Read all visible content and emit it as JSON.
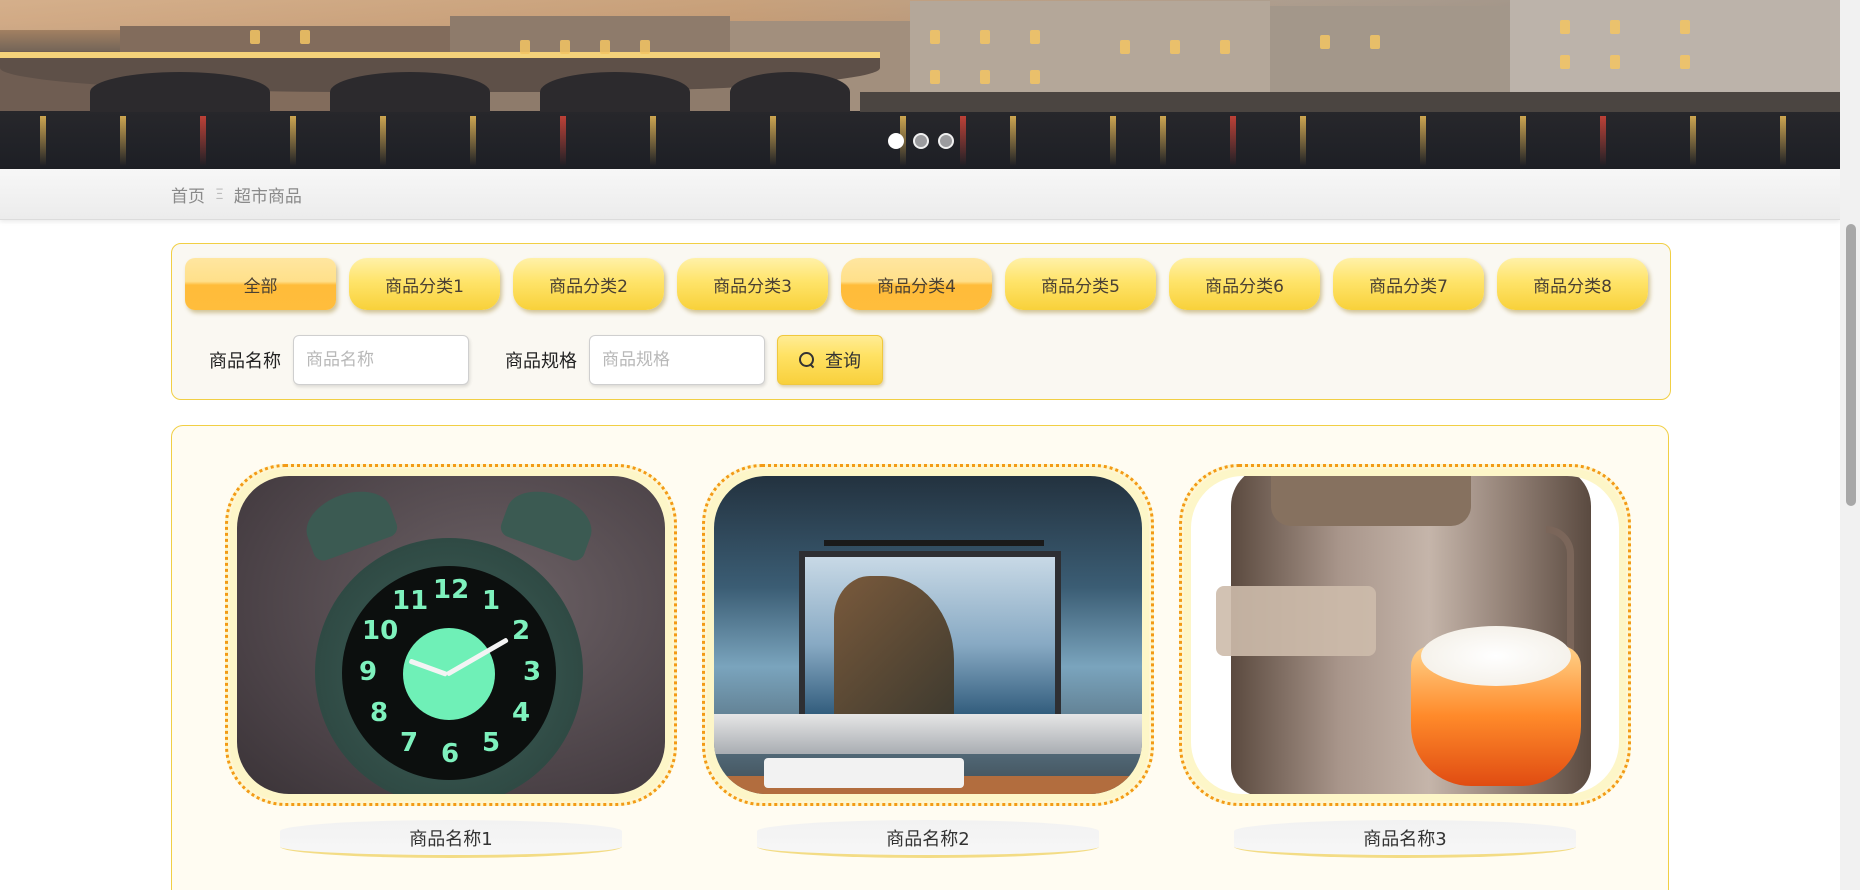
{
  "carousel": {
    "slide_count": 3,
    "active_index": 0
  },
  "breadcrumb": {
    "home": "首页",
    "separator": "Ξ",
    "current": "超市商品"
  },
  "filters": {
    "categories": [
      "全部",
      "商品分类1",
      "商品分类2",
      "商品分类3",
      "商品分类4",
      "商品分类5",
      "商品分类6",
      "商品分类7",
      "商品分类8"
    ],
    "active_category_indices": [
      0,
      4
    ],
    "name_label": "商品名称",
    "name_placeholder": "商品名称",
    "spec_label": "商品规格",
    "spec_placeholder": "商品规格",
    "search_button": "查询",
    "search_icon": "search-icon"
  },
  "products": [
    {
      "name": "商品名称1",
      "image": "alarm-clock-photo"
    },
    {
      "name": "商品名称2",
      "image": "desk-monitor-photo"
    },
    {
      "name": "商品名称3",
      "image": "rice-cooker-photo"
    }
  ],
  "colors": {
    "accent_yellow": "#ffe264",
    "accent_orange": "#f39a16",
    "panel_border": "#f1cf44"
  }
}
